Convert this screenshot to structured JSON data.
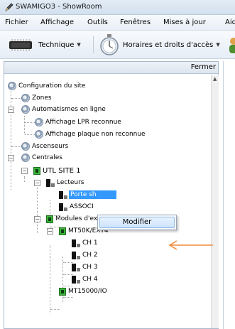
{
  "window": {
    "title": "SWAMIGO3 - ShowRoom"
  },
  "menu": [
    "Fichier",
    "Affichage",
    "Outils",
    "Fenêtres",
    "Mises à jour",
    "Aid"
  ],
  "toolbar": {
    "technique_label": "Technique",
    "horaires_label": "Horaires et droits d'accès"
  },
  "panel": {
    "close_label": "Fermer"
  },
  "tree": {
    "root": "Configuration du site",
    "zones": "Zones",
    "automatismes": "Automatismes en ligne",
    "lpr": "Affichage LPR reconnue",
    "plaque": "Affichage plaque non reconnue",
    "ascenseurs": "Ascenseurs",
    "centrales": "Centrales",
    "utl": "UTL SITE 1",
    "lecteurs": "Lecteurs",
    "porte": "Porte sh",
    "associ": "ASSOCI",
    "modules": "Modules d'extension",
    "mt50k": "MT50K/EXT4",
    "ch": [
      "CH 1",
      "CH 2",
      "CH 3",
      "CH 4"
    ],
    "mt15000": "MT15000/IO"
  },
  "context_menu": {
    "item": "Modifier"
  },
  "colors": {
    "selection": "#3399ff",
    "arrow": "#f08a3a",
    "node_green": "#3cb53c"
  }
}
